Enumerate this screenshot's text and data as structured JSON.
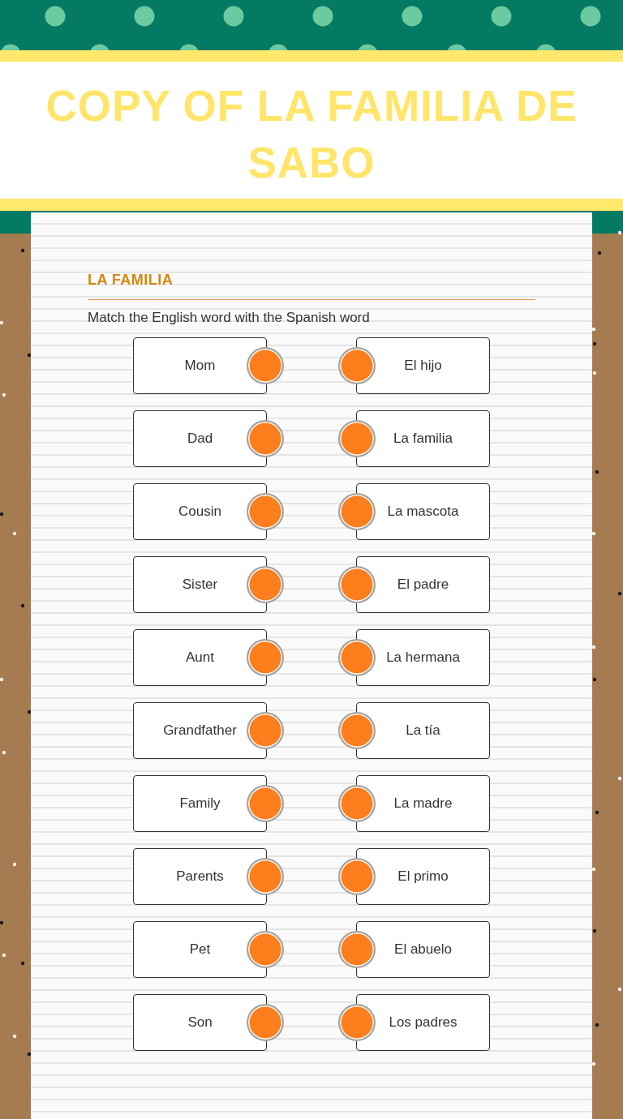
{
  "header": {
    "title": "COPY OF LA FAMILIA DE SABO"
  },
  "section": {
    "title": "LA FAMILIA",
    "instructions": "Match the English word with the Spanish word"
  },
  "rows": [
    {
      "english": "Mom",
      "spanish": "El hijo"
    },
    {
      "english": "Dad",
      "spanish": "La familia"
    },
    {
      "english": "Cousin",
      "spanish": "La mascota"
    },
    {
      "english": "Sister",
      "spanish": "El padre"
    },
    {
      "english": "Aunt",
      "spanish": "La hermana"
    },
    {
      "english": "Grandfather",
      "spanish": "La tía"
    },
    {
      "english": "Family",
      "spanish": "La madre"
    },
    {
      "english": "Parents",
      "spanish": "El primo"
    },
    {
      "english": "Pet",
      "spanish": "El abuelo"
    },
    {
      "english": "Son",
      "spanish": "Los padres"
    }
  ]
}
